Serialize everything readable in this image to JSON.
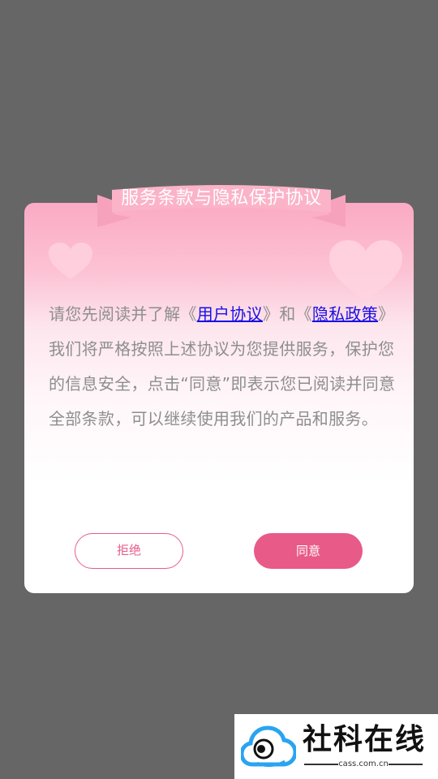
{
  "dialog": {
    "title": "服务条款与隐私保护协议",
    "text_part1": "请您先阅读并了解《",
    "link_user_agreement": "用户协议",
    "text_part2": "》和《",
    "link_privacy_policy": "隐私政策",
    "text_part3": "》我们将严格按照上述协议为您提供服务，保护您的信息安全，点击“同意”即表示您已阅读并同意全部条款，可以继续使用我们的产品和服务。",
    "refuse_label": "拒绝",
    "agree_label": "同意"
  },
  "watermark": {
    "title": "社科在线",
    "subtitle": "cass.com.cn"
  },
  "colors": {
    "overlay": "#666666",
    "accent": "#e85a87",
    "link": "#1a0ee6",
    "body_text": "#8e8e8e"
  }
}
